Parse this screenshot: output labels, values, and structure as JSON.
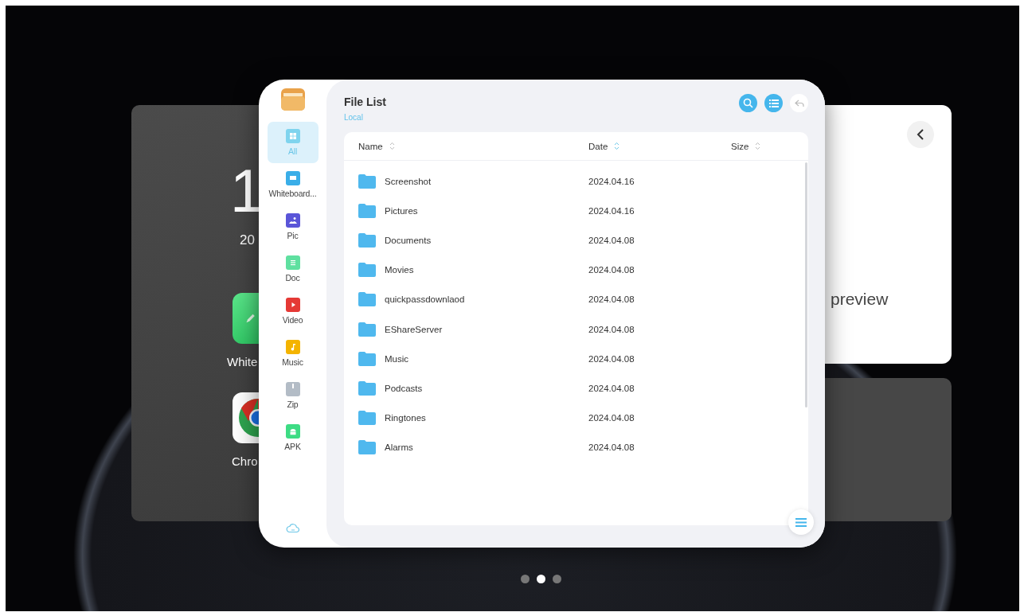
{
  "home_card": {
    "clock": "1",
    "date": "20",
    "apps": [
      {
        "label": "White",
        "kind": "whiteboard"
      },
      {
        "label": "Chro",
        "kind": "browser"
      }
    ]
  },
  "file_manager": {
    "sidebar": {
      "items": [
        {
          "label": "All",
          "kind": "all",
          "color": "#7fd4ee",
          "selected": true
        },
        {
          "label": "Whiteboard...",
          "kind": "whiteboard",
          "color": "#3aaee8",
          "selected": false
        },
        {
          "label": "Pic",
          "kind": "pic",
          "color": "#5a55d8",
          "selected": false
        },
        {
          "label": "Doc",
          "kind": "doc",
          "color": "#5fe0a0",
          "selected": false
        },
        {
          "label": "Video",
          "kind": "video",
          "color": "#e53935",
          "selected": false
        },
        {
          "label": "Music",
          "kind": "music",
          "color": "#f4b400",
          "selected": false
        },
        {
          "label": "Zip",
          "kind": "zip",
          "color": "#b3bcc6",
          "selected": false
        },
        {
          "label": "APK",
          "kind": "apk",
          "color": "#3ddc84",
          "selected": false
        }
      ]
    },
    "title": "File List",
    "location": "Local",
    "columns": [
      "Name",
      "Date",
      "Size"
    ],
    "rows": [
      {
        "name": "Screenshot",
        "date": "2024.04.16"
      },
      {
        "name": "Pictures",
        "date": "2024.04.16"
      },
      {
        "name": "Documents",
        "date": "2024.04.08"
      },
      {
        "name": "Movies",
        "date": "2024.04.08"
      },
      {
        "name": "quickpassdownlaod",
        "date": "2024.04.08"
      },
      {
        "name": "EShareServer",
        "date": "2024.04.08"
      },
      {
        "name": "Music",
        "date": "2024.04.08"
      },
      {
        "name": "Podcasts",
        "date": "2024.04.08"
      },
      {
        "name": "Ringtones",
        "date": "2024.04.08"
      },
      {
        "name": "Alarms",
        "date": "2024.04.08"
      }
    ]
  },
  "preview_card": {
    "text": "preview"
  },
  "pager": [
    {
      "selected": false
    },
    {
      "selected": true
    },
    {
      "selected": false
    }
  ]
}
